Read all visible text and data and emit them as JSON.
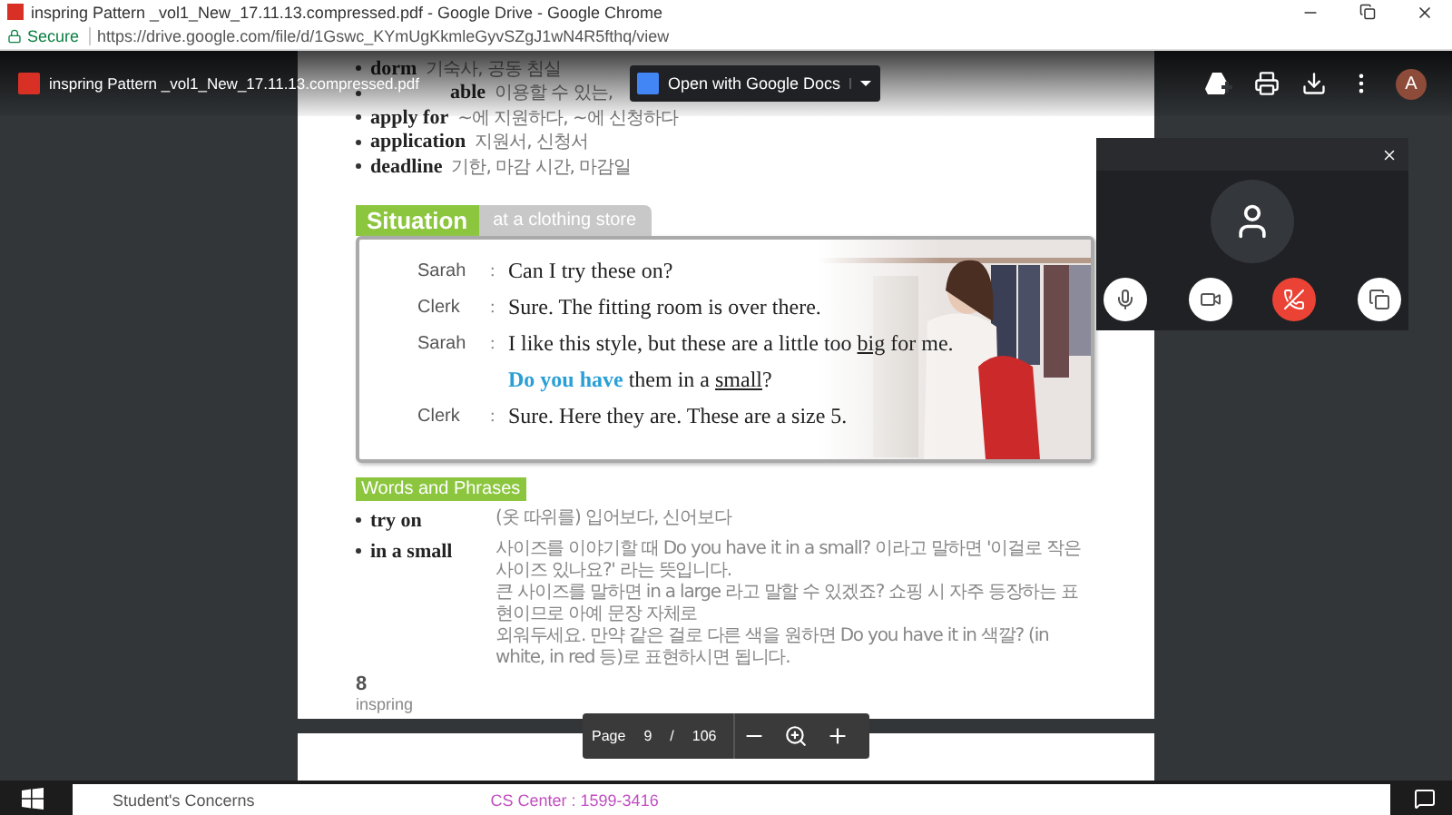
{
  "window": {
    "title": "inspring Pattern _vol1_New_17.11.13.compressed.pdf - Google Drive - Google Chrome"
  },
  "address_bar": {
    "security": "Secure",
    "url": "https://drive.google.com/file/d/1Gswc_KYmUgKkmleGyvSZgJ1wN4R5fthq/view"
  },
  "viewer": {
    "file_name": "inspring Pattern _vol1_New_17.11.13.compressed.pdf",
    "open_with": "Open with Google Docs",
    "avatar": "A"
  },
  "page": {
    "vocab": [
      {
        "term": "dorm",
        "meaning": "기숙사, 공동 침실",
        "lead_hidden": false
      },
      {
        "term": "able",
        "meaning": "이용할 수 있는,",
        "lead_hidden": true
      },
      {
        "term": "apply for",
        "meaning": "~에 지원하다, ~에 신청하다",
        "lead_hidden": false
      },
      {
        "term": "application",
        "meaning": "지원서, 신청서",
        "lead_hidden": false
      },
      {
        "term": "deadline",
        "meaning": "기한, 마감 시간, 마감일",
        "lead_hidden": false
      }
    ],
    "situation": {
      "label": "Situation",
      "topic": "at a clothing store",
      "lines": [
        {
          "speaker": "Sarah",
          "sep": ":",
          "parts": [
            {
              "kind": "plain",
              "text": "Can I try these on?"
            }
          ]
        },
        {
          "speaker": "Clerk",
          "sep": ":",
          "parts": [
            {
              "kind": "plain",
              "text": "Sure. The fitting room is over there."
            }
          ]
        },
        {
          "speaker": "Sarah",
          "sep": ":",
          "parts": [
            {
              "kind": "plain",
              "text": "I like this style, but these are a little too "
            },
            {
              "kind": "underline",
              "text": "big"
            },
            {
              "kind": "plain",
              "text": " for me."
            }
          ]
        },
        {
          "parts": [
            {
              "kind": "highlight",
              "text": "Do you have"
            },
            {
              "kind": "plain",
              "text": " them in a "
            },
            {
              "kind": "underline",
              "text": "small"
            },
            {
              "kind": "plain",
              "text": "?"
            }
          ]
        },
        {
          "speaker": "Clerk",
          "sep": ":",
          "parts": [
            {
              "kind": "plain",
              "text": "Sure. Here they are. These are a size 5."
            }
          ]
        }
      ]
    },
    "words_heading": "Words and Phrases",
    "phrases": [
      {
        "term": "try on",
        "meaning": [
          "(옷 따위를) 입어보다, 신어보다"
        ]
      },
      {
        "term": "in a small",
        "meaning": [
          "사이즈를 이야기할 때 Do you have it in a small? 이라고 말하면 '이걸로 작은 사이즈 있나요?' 라는 뜻입니다.",
          "큰 사이즈를 말하면 in a large 라고 말할 수 있겠죠? 쇼핑 시 자주 등장하는 표현이므로 아예 문장 자체로",
          "외워두세요. 만약 같은 걸로 다른 색을 원하면 Do you have it in 색깔? (in white, in red 등)로 표현하시면 됩니다."
        ]
      }
    ],
    "page_number": "8",
    "footer": "inspring"
  },
  "page_controls": {
    "label": "Page",
    "current": "9",
    "separator": "/",
    "total": "106"
  },
  "taskbar": {
    "window_texts": [
      "Student's Concerns",
      "CS Center : 1599-3416"
    ]
  }
}
